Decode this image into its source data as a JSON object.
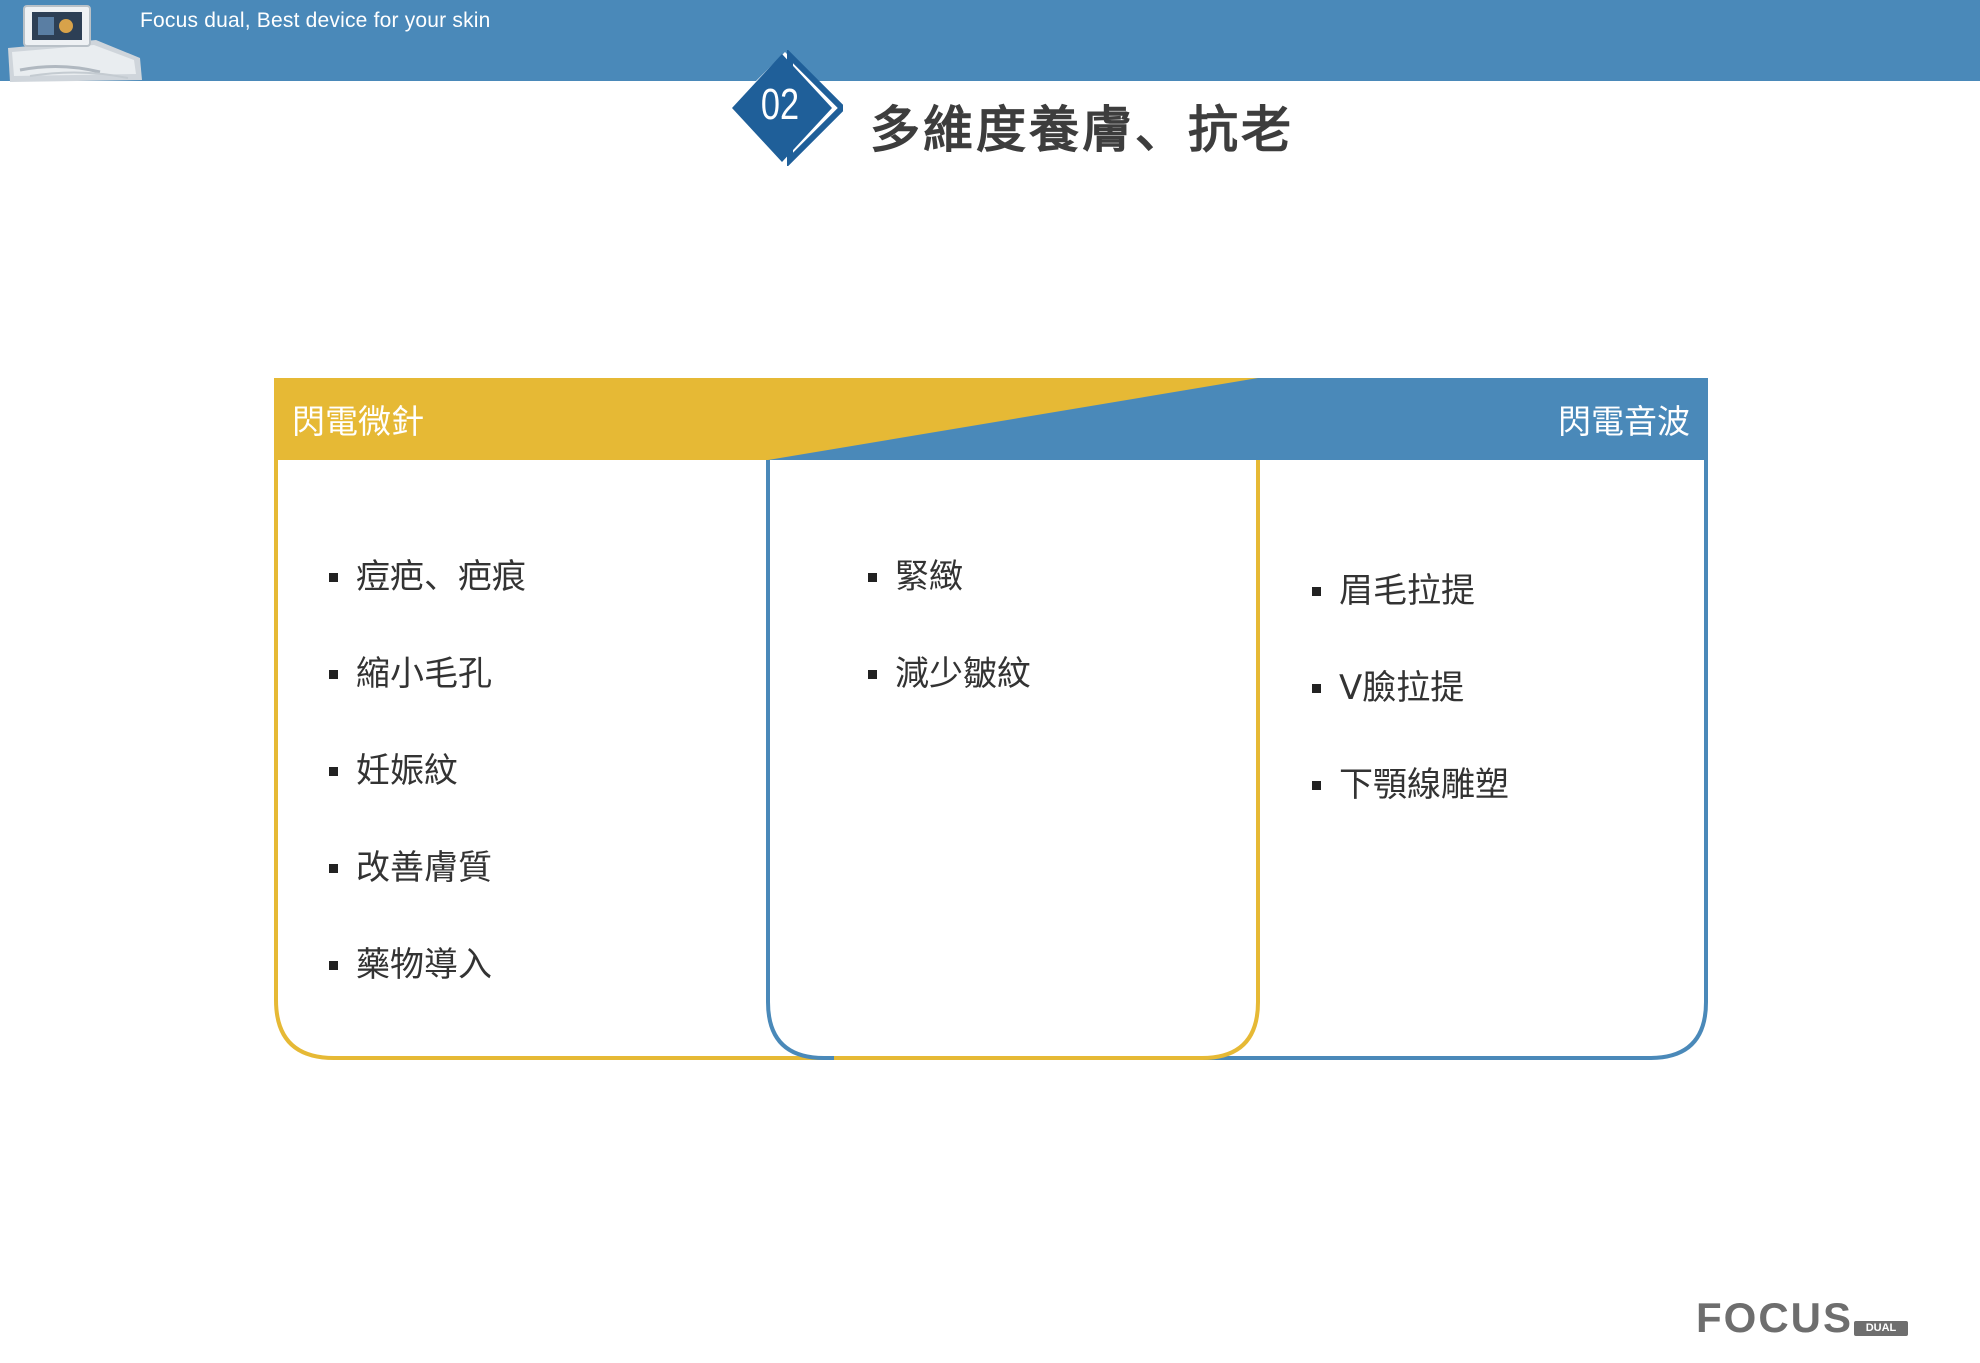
{
  "header": {
    "tagline": "Focus dual, Best device for your skin",
    "device_image": "device-thumbnail"
  },
  "section": {
    "number": "02",
    "title": "多維度養膚、抗老"
  },
  "diagram": {
    "left_label": "閃電微針",
    "right_label": "閃電音波",
    "left_items": [
      "痘疤、疤痕",
      "縮小毛孔",
      "妊娠紋",
      "改善膚質",
      "藥物導入"
    ],
    "middle_items": [
      "緊緻",
      "減少皺紋"
    ],
    "right_items": [
      "眉毛拉提",
      "V臉拉提",
      "下顎線雕塑"
    ],
    "colors": {
      "yellow": "#e6b935",
      "blue": "#4a89b9"
    }
  },
  "logo": {
    "text": "FOCUS",
    "sub": "DUAL"
  }
}
